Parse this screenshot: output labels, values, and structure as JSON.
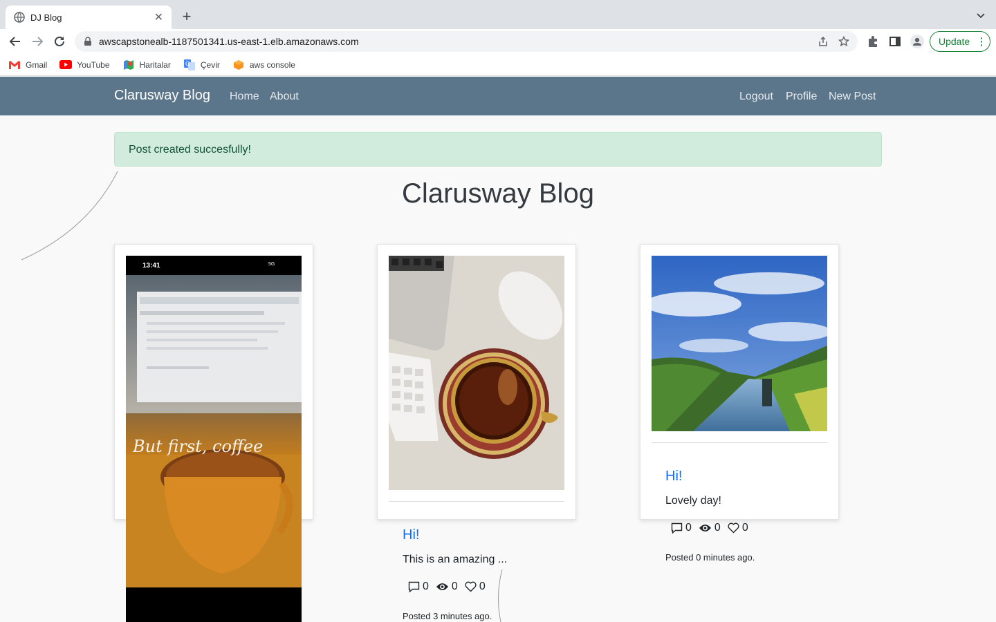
{
  "browser": {
    "tab_title": "DJ Blog",
    "url": "awscapstonealb-1187501341.us-east-1.elb.amazonaws.com",
    "update_label": "Update",
    "bookmarks": [
      "Gmail",
      "YouTube",
      "Haritalar",
      "Çevir",
      "aws console"
    ]
  },
  "nav": {
    "brand": "Clarusway Blog",
    "left_links": [
      "Home",
      "About"
    ],
    "right_links": [
      "Logout",
      "Profile",
      "New Post"
    ]
  },
  "alert": {
    "message": "Post created succesfully!"
  },
  "page_title": "Clarusway Blog",
  "posts": [
    {
      "image_overlay_time": "13:41",
      "image_overlay_signal": "5G",
      "image_overlay_caption": "But first, coffee"
    },
    {
      "title": "Hi!",
      "excerpt": "This is an amazing ...",
      "comments": "0",
      "views": "0",
      "likes": "0",
      "posted": "Posted 3 minutes ago."
    },
    {
      "title": "Hi!",
      "excerpt": "Lovely day!",
      "comments": "0",
      "views": "0",
      "likes": "0",
      "posted": "Posted 0 minutes ago."
    }
  ]
}
